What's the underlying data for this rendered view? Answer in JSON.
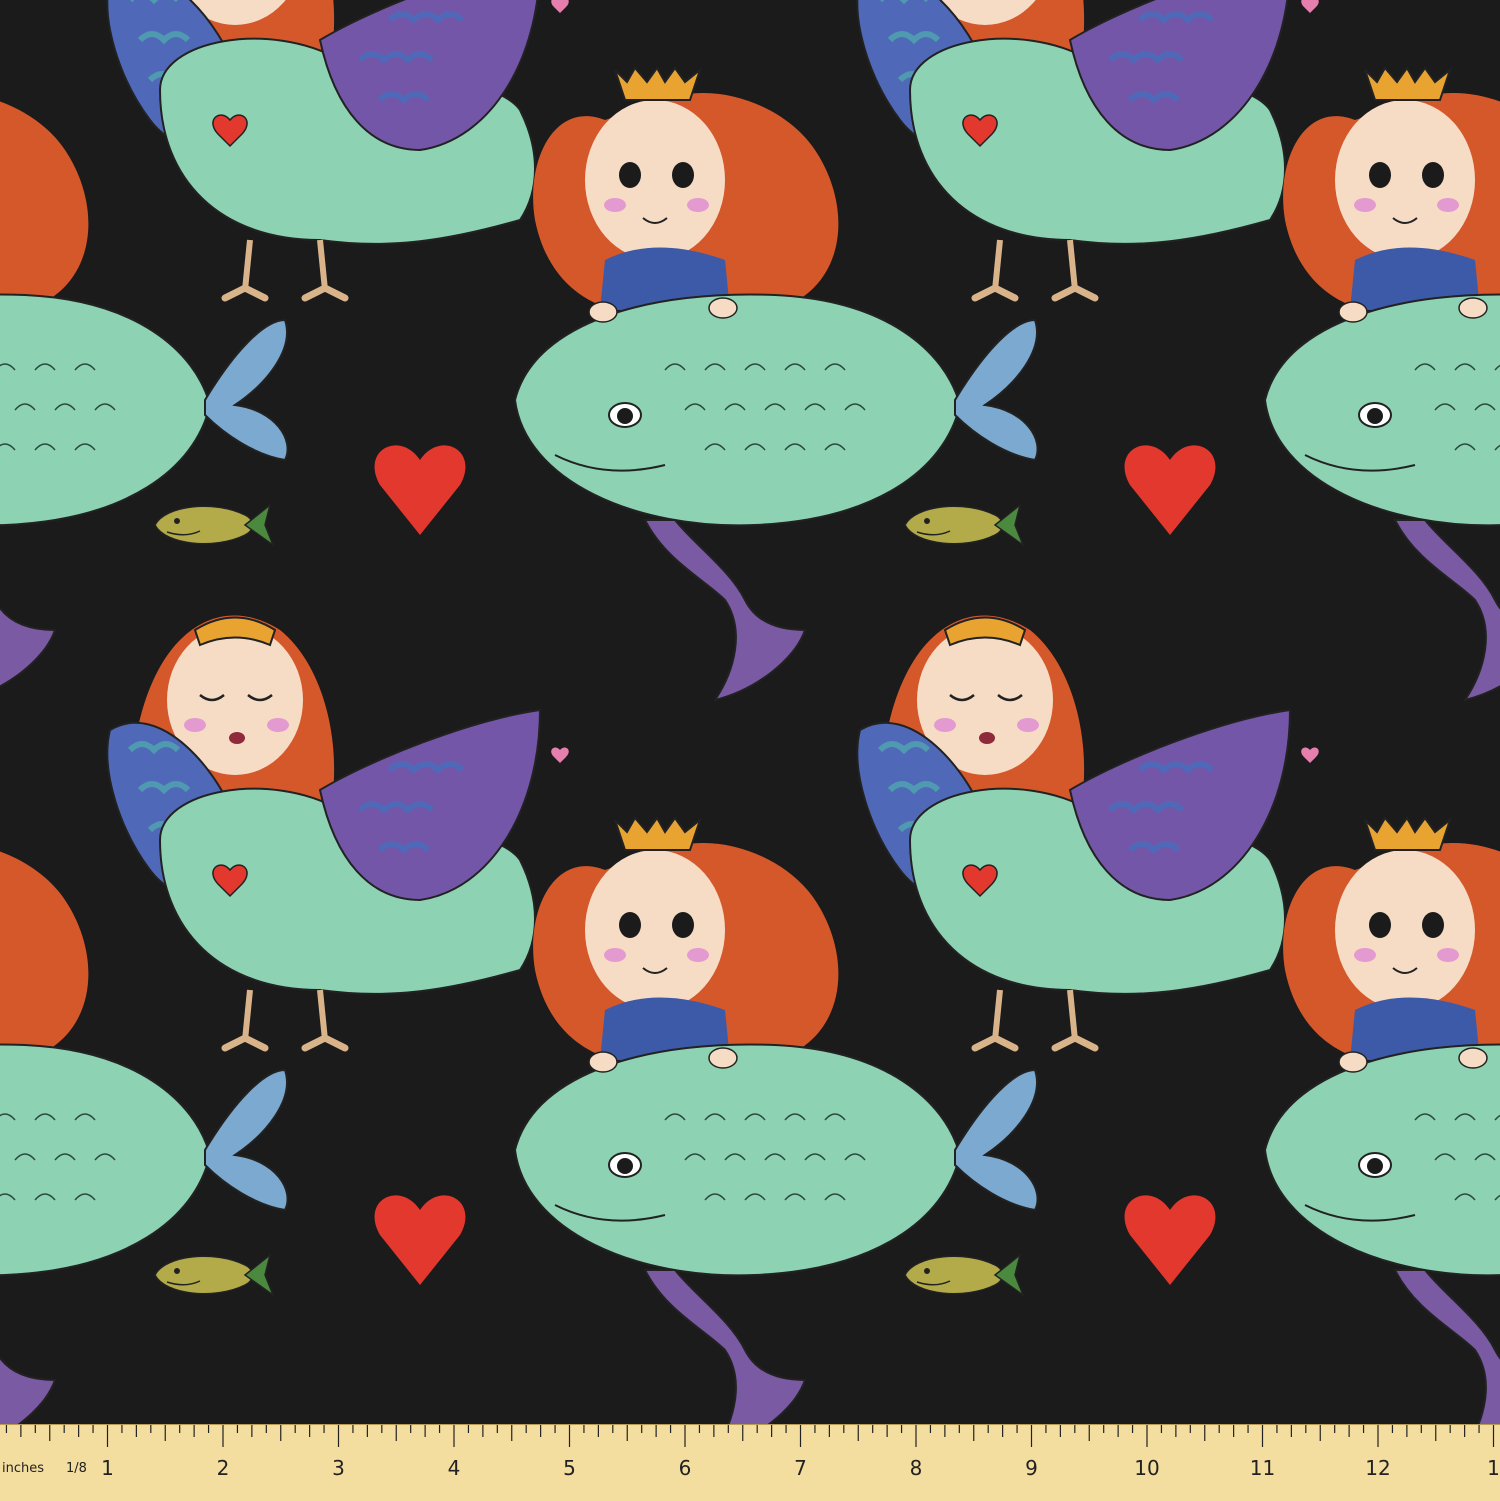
{
  "fabric": {
    "pattern_name": "",
    "colors": {
      "background": "#1b1b1c",
      "fish_body": "#8ed2b4",
      "fish_fin": "#7ba9cf",
      "hair": "#d5582a",
      "hair_light": "#e8782e",
      "skin": "#f6dcc5",
      "crown": "#e9a330",
      "wing_blue": "#4f69b8",
      "wing_purple": "#7456a8",
      "wing_teal": "#4f9ab0",
      "tail_purple": "#7b5aa4",
      "heart": "#e2382e",
      "small_fish": "#b3ab4a",
      "dress_blue": "#3c5aa8",
      "ruler": "#f3dd9f"
    }
  },
  "ruler": {
    "unit_label": "inches",
    "fraction_label": "1/8",
    "numbers": [
      "1",
      "2",
      "3",
      "4",
      "5",
      "6",
      "7",
      "8",
      "9",
      "10",
      "11",
      "12",
      "1"
    ]
  }
}
